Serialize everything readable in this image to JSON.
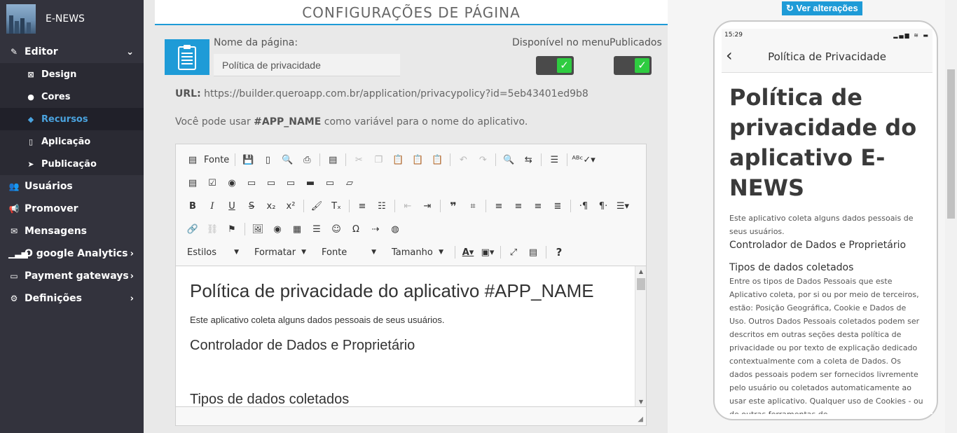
{
  "brand": {
    "name": "E-NEWS"
  },
  "sidebar": {
    "items": [
      {
        "label": "Editor",
        "icon": "pencil-icon"
      },
      {
        "label": "Design",
        "icon": "design-icon"
      },
      {
        "label": "Cores",
        "icon": "palette-icon"
      },
      {
        "label": "Recursos",
        "icon": "cube-icon"
      },
      {
        "label": "Aplicação",
        "icon": "mobile-icon"
      },
      {
        "label": "Publicação",
        "icon": "paper-plane-icon"
      },
      {
        "label": "Usuários",
        "icon": "users-icon"
      },
      {
        "label": "Promover",
        "icon": "megaphone-icon"
      },
      {
        "label": "Mensagens",
        "icon": "envelope-icon"
      },
      {
        "label": "O google Analytics",
        "icon": "chart-icon"
      },
      {
        "label": "Payment gateways",
        "icon": "credit-card-icon"
      },
      {
        "label": "Definições",
        "icon": "cogs-icon"
      }
    ]
  },
  "header": {
    "title": "CONFIGURAÇÕES DE PÁGINA"
  },
  "form": {
    "name_label": "Nome da página:",
    "name_value": "Política de privacidade",
    "menu_label": "Disponível no menu",
    "published_label": "Publicados",
    "url_label": "URL:",
    "url_value": "https://builder.queroapp.com.br/application/privacypolicy?id=5eb43401ed9b8",
    "tip_before": "Você pode usar ",
    "tip_var": "#APP_NAME",
    "tip_after": " como variável para o nome do aplicativo."
  },
  "toolbar": {
    "source_label": "Fonte",
    "styles_label": "Estilos",
    "format_label": "Formatar",
    "font_label": "Fonte",
    "size_label": "Tamanho"
  },
  "editor": {
    "h1": "Política de privacidade do aplicativo #APP_NAME",
    "p1": "Este aplicativo coleta alguns dados pessoais de seus usuários.",
    "h2a": "Controlador de Dados e Proprietário",
    "h2b": "Tipos de dados coletados"
  },
  "preview": {
    "button": "Ver alterações",
    "time": "15:29",
    "title": "Política de Privacidade",
    "h1": "Política de privacidade do aplicativo E-NEWS",
    "p1": "Este aplicativo coleta alguns dados pessoais de seus usuários.",
    "h2a": "Controlador de Dados e Proprietário",
    "h2b": "Tipos de dados coletados",
    "p2": "Entre os tipos de Dados Pessoais que este Aplicativo coleta, por si ou por meio de terceiros, estão: Posição Geográfica, Cookie e Dados de Uso. Outros Dados Pessoais coletados podem ser descritos em outras seções desta política de privacidade ou por texto de explicação dedicado contextualmente com a coleta de Dados. Os dados pessoais podem ser fornecidos livremente pelo usuário ou coletados automaticamente ao usar este aplicativo. Qualquer uso de Cookies - ou de outras ferramentas de"
  },
  "colors": {
    "accent": "#1e9bd7",
    "sidebar": "#33333d",
    "toggle_on": "#2ecc40"
  }
}
